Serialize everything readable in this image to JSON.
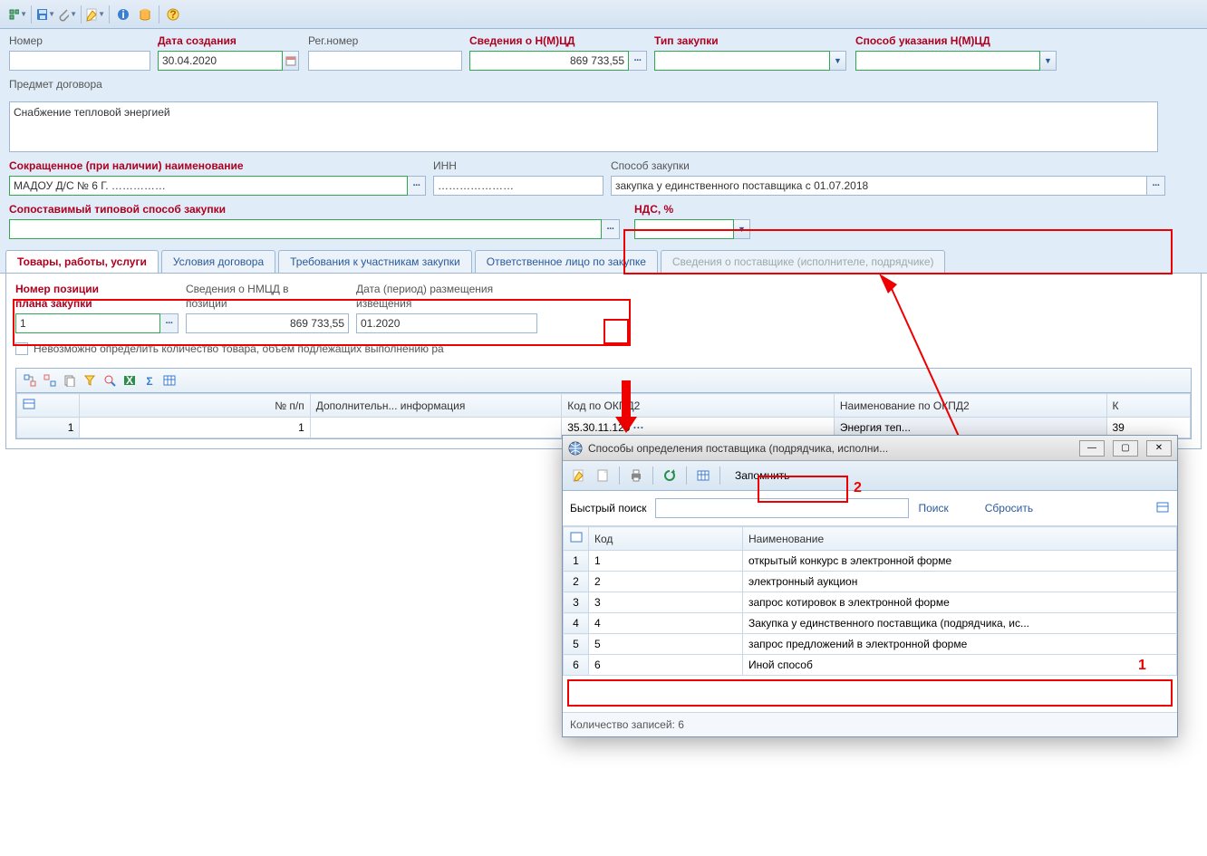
{
  "form": {
    "number_label": "Номер",
    "number_value": "",
    "date_label": "Дата создания",
    "date_value": "30.04.2020",
    "reg_label": "Рег.номер",
    "reg_value": "",
    "nmcd_label": "Сведения о Н(М)ЦД",
    "nmcd_value": "869 733,55",
    "type_label": "Тип закупки",
    "type_value": "",
    "spec_label": "Способ указания Н(М)ЦД",
    "spec_value": "",
    "subject_label": "Предмет договора",
    "subject_value": "Снабжение тепловой энергией",
    "shortname_label": "Сокращенное (при наличии) наименование",
    "shortname_value": "МАДОУ Д/С № 6 Г. ……………",
    "inn_label": "ИНН",
    "inn_value": "…………………",
    "method_label": "Способ закупки",
    "method_value": "закупка у единственного поставщика с 01.07.2018",
    "typical_label": "Сопоставимый типовой способ закупки",
    "typical_value": "",
    "vat_label": "НДС, %",
    "vat_value": ""
  },
  "tabs": {
    "t1": "Товары, работы, услуги",
    "t2": "Условия договора",
    "t3": "Требования к участникам закупки",
    "t4": "Ответственное лицо по закупке",
    "t5": "Сведения о поставщике (исполнителе, подрядчике)"
  },
  "tab1": {
    "pos_label1": "Номер позиции",
    "pos_label2": "плана закупки",
    "pos_value": "1",
    "nmcd_pos_label1": "Сведения о НМЦД в",
    "nmcd_pos_label2": "позиции",
    "nmcd_pos_value": "869 733,55",
    "date_pub_label1": "Дата (период) размещения",
    "date_pub_label2": "извещения",
    "date_pub_value": "01.2020",
    "checkbox": "Невозможно определить количество товара, объем подлежащих выполнению ра"
  },
  "grid": {
    "h_num": "№ п/п",
    "h_add": "Дополнительн... информация",
    "h_okpd": "Код по ОКПД2",
    "h_name": "Наименование по ОКПД2",
    "h_k": "К",
    "row": {
      "num": "1",
      "add": "",
      "okpd": "35.30.11.120",
      "name": "Энергия теп...",
      "k": "39"
    }
  },
  "dialog": {
    "title": "Способы определения поставщика (подрядчика, исполни...",
    "remember": "Запомнить",
    "search_label": "Быстрый поиск",
    "search_btn": "Поиск",
    "reset_btn": "Сбросить",
    "h_code": "Код",
    "h_name": "Наименование",
    "rows": [
      {
        "n": "1",
        "code": "1",
        "name": "открытый конкурс в электронной форме"
      },
      {
        "n": "2",
        "code": "2",
        "name": "электронный аукцион"
      },
      {
        "n": "3",
        "code": "3",
        "name": "запрос котировок в электронной форме"
      },
      {
        "n": "4",
        "code": "4",
        "name": "Закупка у единственного поставщика (подрядчика, ис..."
      },
      {
        "n": "5",
        "code": "5",
        "name": "запрос предложений в электронной форме"
      },
      {
        "n": "6",
        "code": "6",
        "name": "Иной способ"
      }
    ],
    "status": "Количество записей: 6"
  },
  "callouts": {
    "one": "1",
    "two": "2"
  }
}
